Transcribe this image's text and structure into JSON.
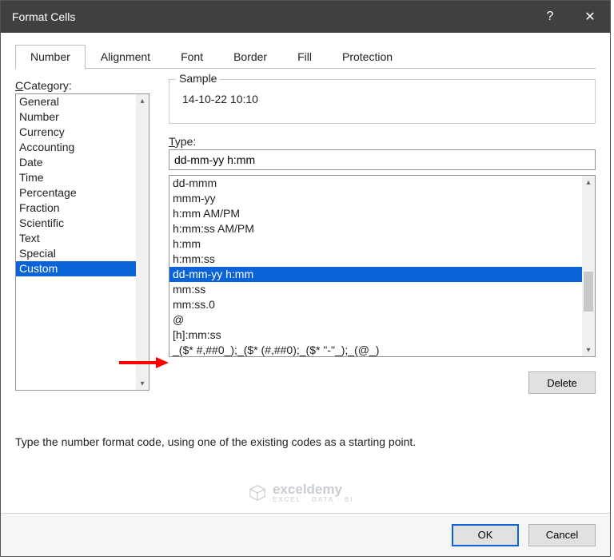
{
  "titlebar": {
    "title": "Format Cells",
    "help_label": "?",
    "close_label": "✕"
  },
  "tabs": [
    {
      "label": "Number",
      "active": true
    },
    {
      "label": "Alignment"
    },
    {
      "label": "Font"
    },
    {
      "label": "Border"
    },
    {
      "label": "Fill"
    },
    {
      "label": "Protection"
    }
  ],
  "category": {
    "label": "Category:",
    "items": [
      {
        "label": "General"
      },
      {
        "label": "Number"
      },
      {
        "label": "Currency"
      },
      {
        "label": "Accounting"
      },
      {
        "label": "Date"
      },
      {
        "label": "Time"
      },
      {
        "label": "Percentage"
      },
      {
        "label": "Fraction"
      },
      {
        "label": "Scientific"
      },
      {
        "label": "Text"
      },
      {
        "label": "Special"
      },
      {
        "label": "Custom",
        "selected": true
      }
    ]
  },
  "sample": {
    "legend": "Sample",
    "value": "14-10-22 10:10"
  },
  "type": {
    "label": "Type:",
    "value": "dd-mm-yy h:mm",
    "options": [
      {
        "label": "dd-mmm"
      },
      {
        "label": "mmm-yy"
      },
      {
        "label": "h:mm AM/PM"
      },
      {
        "label": "h:mm:ss AM/PM"
      },
      {
        "label": "h:mm"
      },
      {
        "label": "h:mm:ss"
      },
      {
        "label": "dd-mm-yy h:mm",
        "selected": true
      },
      {
        "label": "mm:ss"
      },
      {
        "label": "mm:ss.0"
      },
      {
        "label": "@"
      },
      {
        "label": "[h]:mm:ss"
      },
      {
        "label": "_($* #,##0_);_($* (#,##0);_($* \"-\"_);_(@_)"
      }
    ]
  },
  "delete_label": "Delete",
  "hint": "Type the number format code, using one of the existing codes as a starting point.",
  "footer": {
    "ok_label": "OK",
    "cancel_label": "Cancel"
  },
  "branding": {
    "name": "exceldemy",
    "tagline": "EXCEL · DATA · BI"
  }
}
